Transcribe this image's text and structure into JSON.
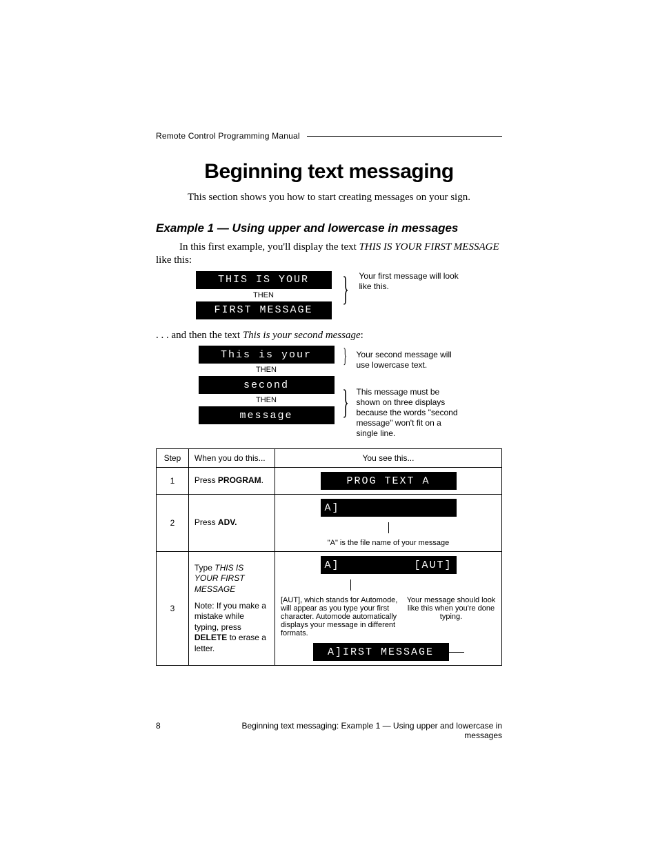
{
  "running_head": "Remote Control Programming Manual",
  "title": "Beginning text messaging",
  "intro": "This section shows you how to start creating messages on your sign.",
  "example_heading": "Example 1 — Using upper and lowercase in messages",
  "para1_pre": "In this first example, you'll display the text ",
  "para1_em": "THIS IS YOUR FIRST MESSAGE",
  "para1_post": " like this:",
  "fig1": {
    "line1": "THIS IS YOUR",
    "then": "THEN",
    "line2": "FIRST MESSAGE",
    "annot": "Your first message will look like this."
  },
  "para2_pre": ". . . and then the text ",
  "para2_em": "This is your second message",
  "para2_post": ":",
  "fig2": {
    "line1": "This is your",
    "then1": "THEN",
    "line2": "second",
    "then2": "THEN",
    "line3": "message",
    "annot1": "Your second message will use lowercase text.",
    "annot2": "This message must be shown on three displays because the words \"second message\" won't fit on a single line."
  },
  "table": {
    "headers": {
      "step": "Step",
      "when": "When you do this...",
      "see": "You see this..."
    },
    "rows": [
      {
        "step": "1",
        "when_pre": "Press ",
        "when_bold": "PROGRAM",
        "when_post": ".",
        "display": "PROG TEXT A"
      },
      {
        "step": "2",
        "when_pre": "Press ",
        "when_bold": "ADV.",
        "display": "A]",
        "caption": "\"A\" is the file name of your message"
      },
      {
        "step": "3",
        "when_pre": "Type ",
        "when_em": "THIS IS YOUR FIRST MESSAGE",
        "note_pre": "Note:  If you make a mistake while typing, press ",
        "note_bold": "DELETE",
        "note_post": " to erase a letter.",
        "display1_left": "A]",
        "display1_right": "[AUT]",
        "caption_left": "[AUT], which stands for Automode, will appear as you type your first character. Automode automatically displays your message in different formats.",
        "caption_right": "Your message should look like this when you're done typing.",
        "display2": "A]IRST MESSAGE"
      }
    ]
  },
  "footer": {
    "page": "8",
    "text": "Beginning text messaging: Example 1 — Using upper and lowercase in messages"
  }
}
